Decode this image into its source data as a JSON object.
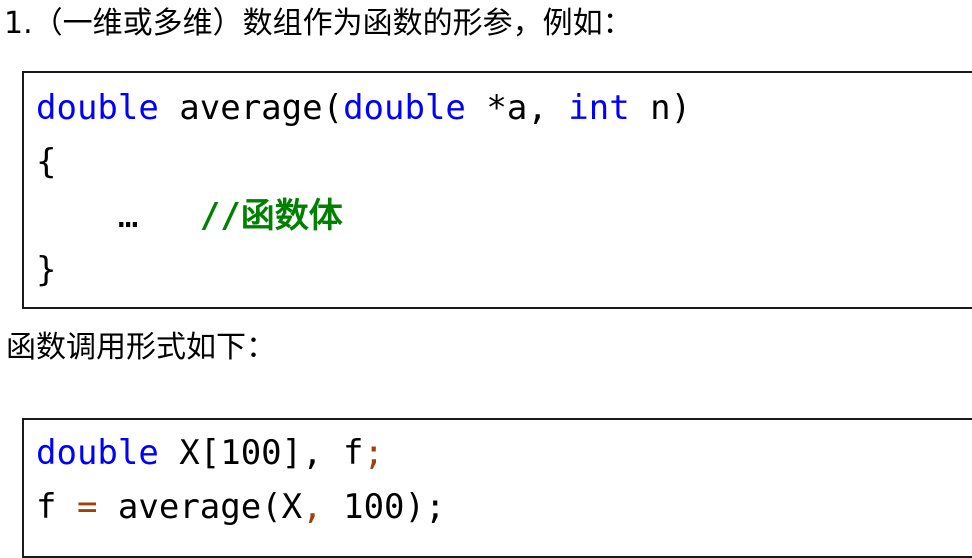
{
  "document": {
    "heading": "1.（一维或多维）数组作为函数的形参，例如：",
    "mid_text": "函数调用形式如下："
  },
  "colors": {
    "keyword": "#0000ff",
    "comment": "#008000",
    "punctuation": "#a0400a",
    "text": "#000000",
    "box_border": "#1a1a1a",
    "background": "#ffffff"
  },
  "code_block_1": {
    "line1": {
      "kw1": "double",
      "name": " average(",
      "kw2": "double",
      "arg1": " *a, ",
      "kw3": "int",
      "arg2": " n)"
    },
    "line2": "{",
    "line3": {
      "indent": "    ",
      "dots": "…",
      "gap": "   ",
      "comment": "//函数体"
    },
    "line4": "}"
  },
  "code_block_2": {
    "line1": {
      "kw1": "double",
      "decl": " X[100], f",
      "semi": ";"
    },
    "line2": {
      "var": "f ",
      "eq": "=",
      "call1": " average(X",
      "comma": ",",
      "call2": " 100);"
    }
  }
}
